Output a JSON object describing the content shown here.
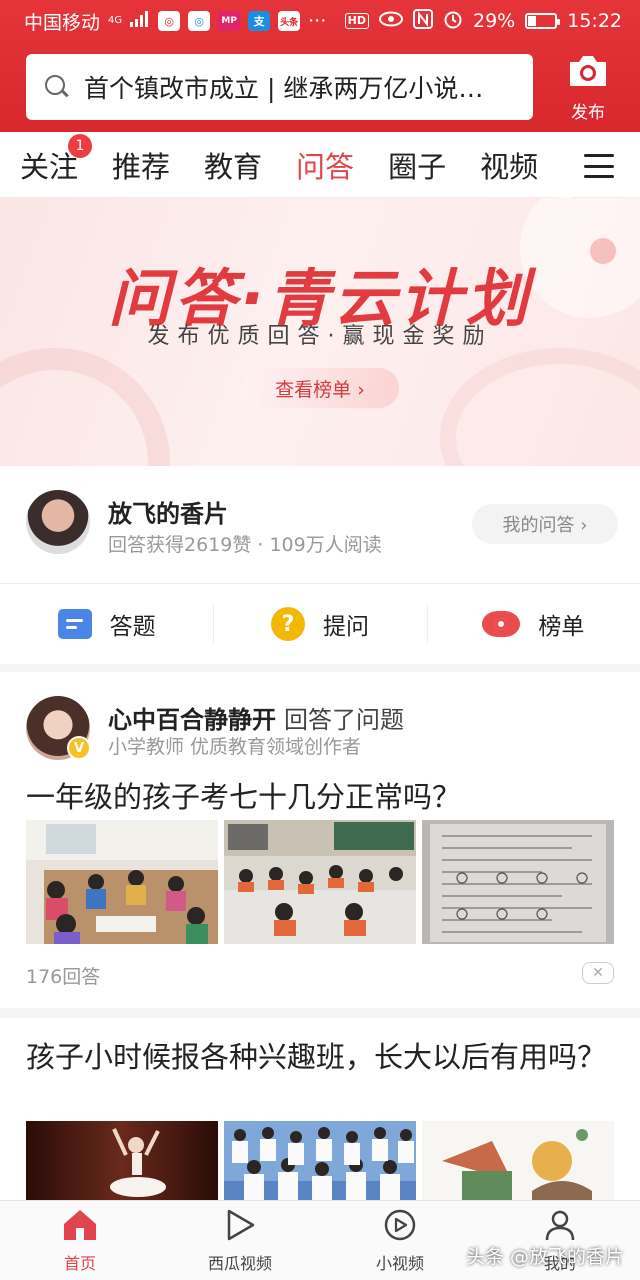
{
  "status_bar": {
    "carrier": "中国移动",
    "network": "4G",
    "app_icons": [
      "◎",
      "◎",
      "MP",
      "支",
      "头条"
    ],
    "more": "···",
    "hd": "HD",
    "battery_level": "29%",
    "battery_fraction": 0.29,
    "time": "15:22"
  },
  "search": {
    "text": "首个镇改市成立 | 继承两万亿小说…"
  },
  "publish": {
    "label": "发布"
  },
  "tabs": [
    {
      "label": "关注",
      "badge": "1"
    },
    {
      "label": "推荐"
    },
    {
      "label": "教育"
    },
    {
      "label": "问答",
      "active": true
    },
    {
      "label": "圈子"
    },
    {
      "label": "视频"
    }
  ],
  "banner": {
    "title": "问答·青云计划",
    "subtitle": "发布优质回答·赢现金奖励",
    "button": "查看榜单 ›"
  },
  "profile": {
    "name": "放飞的香片",
    "stats": "回答获得2619赞 · 109万人阅读",
    "button": "我的问答 ›"
  },
  "actions": [
    {
      "label": "答题",
      "icon": "answer-icon"
    },
    {
      "label": "提问",
      "icon": "question-icon"
    },
    {
      "label": "榜单",
      "icon": "rank-eye-icon"
    }
  ],
  "card1": {
    "author": "心中百合静静开",
    "action": "回答了问题",
    "verified": "V",
    "desc": "小学教师 优质教育领域创作者",
    "title": "一年级的孩子考七十几分正常吗？",
    "meta": "176回答",
    "dislike": "✕"
  },
  "card2": {
    "title": "孩子小时候报各种兴趣班，长大以后有用吗？"
  },
  "bottom_nav": [
    {
      "label": "首页",
      "icon": "home-icon",
      "active": true
    },
    {
      "label": "西瓜视频",
      "icon": "play-icon"
    },
    {
      "label": "小视频",
      "icon": "small-video-icon"
    },
    {
      "label": "我的",
      "icon": "user-icon"
    }
  ],
  "watermark": "头条 @放飞的香片",
  "colors": {
    "brand_red": "#d8272d",
    "active_tab": "#e2444b",
    "verified": "#f7c221"
  }
}
